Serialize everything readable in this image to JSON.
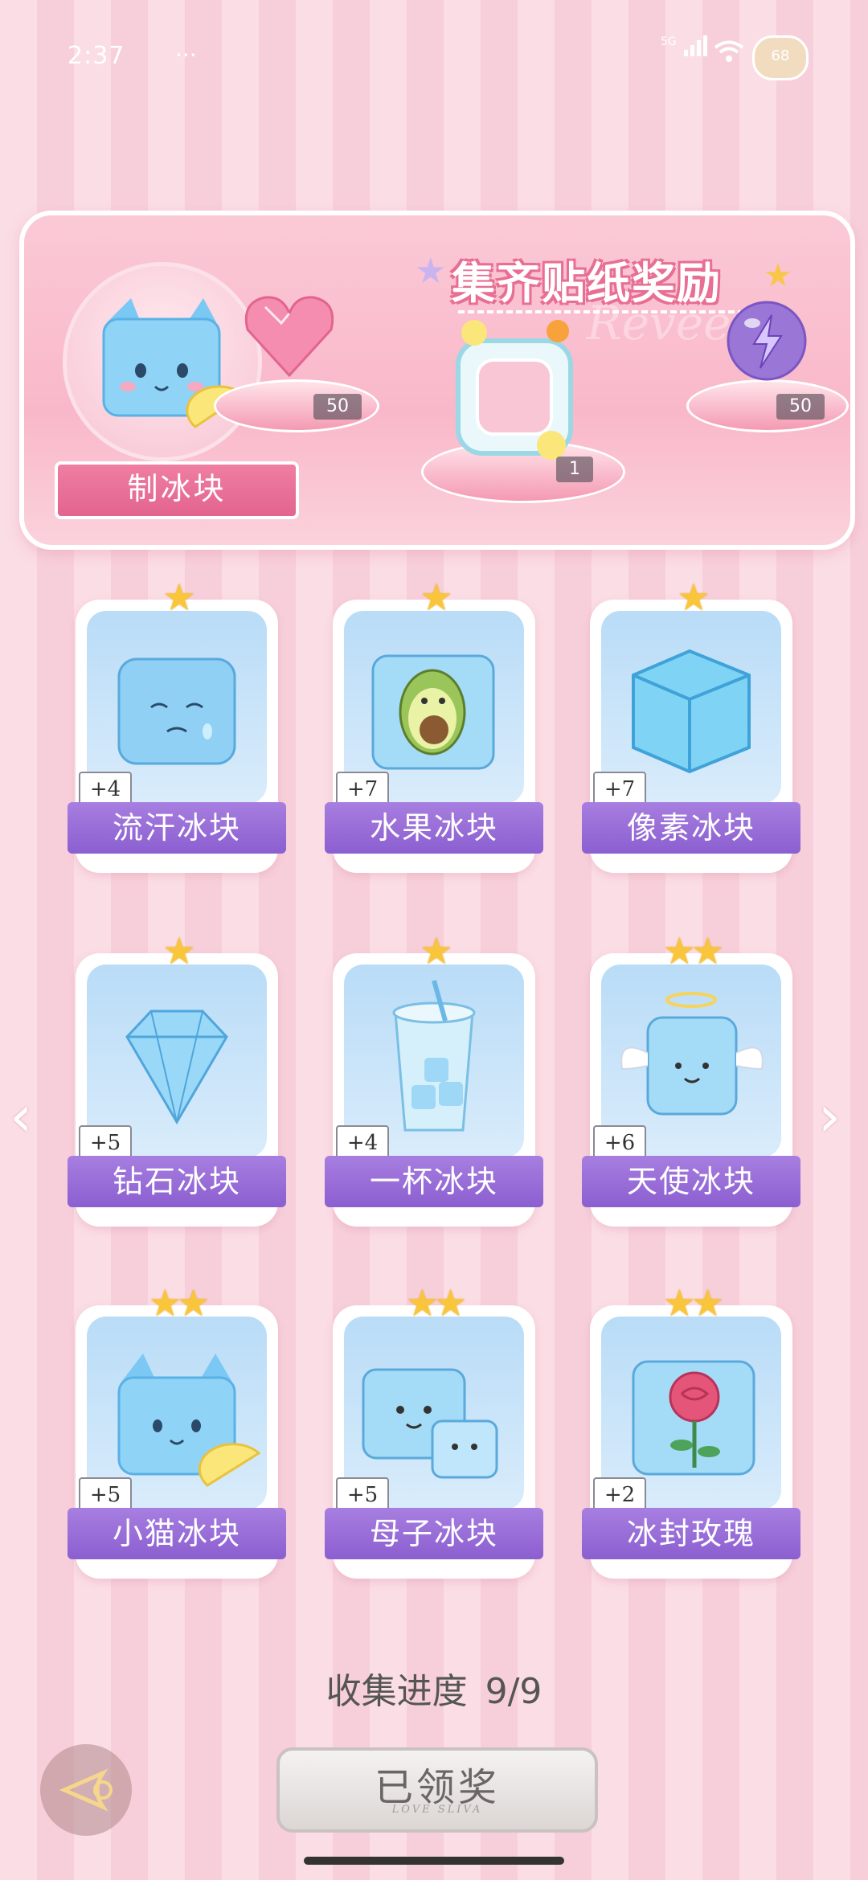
{
  "status_bar": {
    "time": "2:37",
    "dots": "···",
    "network": "5G",
    "battery": "68"
  },
  "banner": {
    "title": "集齐贴纸奖励",
    "watermark": "Reveem",
    "featured_label": "制冰块",
    "rewards": [
      {
        "icon": "heart-gem-icon",
        "count": "50"
      },
      {
        "icon": "sticker-frame-icon",
        "count": "1"
      },
      {
        "icon": "purple-orb-icon",
        "count": "50"
      }
    ]
  },
  "cards": [
    {
      "name": "流汗冰块",
      "plus": "+4",
      "stars": "★",
      "icon": "sweating-ice-cube-icon"
    },
    {
      "name": "水果冰块",
      "plus": "+7",
      "stars": "★",
      "icon": "avocado-ice-cube-icon"
    },
    {
      "name": "像素冰块",
      "plus": "+7",
      "stars": "★",
      "icon": "pixel-ice-cube-icon"
    },
    {
      "name": "钻石冰块",
      "plus": "+5",
      "stars": "★",
      "icon": "diamond-ice-icon"
    },
    {
      "name": "一杯冰块",
      "plus": "+4",
      "stars": "★",
      "icon": "cup-of-ice-icon"
    },
    {
      "name": "天使冰块",
      "plus": "+6",
      "stars": "★★",
      "icon": "angel-ice-cube-icon"
    },
    {
      "name": "小猫冰块",
      "plus": "+5",
      "stars": "★★",
      "icon": "cat-ice-cube-icon"
    },
    {
      "name": "母子冰块",
      "plus": "+5",
      "stars": "★★",
      "icon": "mother-child-ice-icon"
    },
    {
      "name": "冰封玫瑰",
      "plus": "+2",
      "stars": "★★",
      "icon": "frozen-rose-icon"
    }
  ],
  "progress": {
    "label": "收集进度",
    "value": "9/9"
  },
  "claim": {
    "label": "已领奖",
    "sub": "LOVE SLIVA"
  },
  "nav": {
    "prev": "‹",
    "next": "›"
  }
}
